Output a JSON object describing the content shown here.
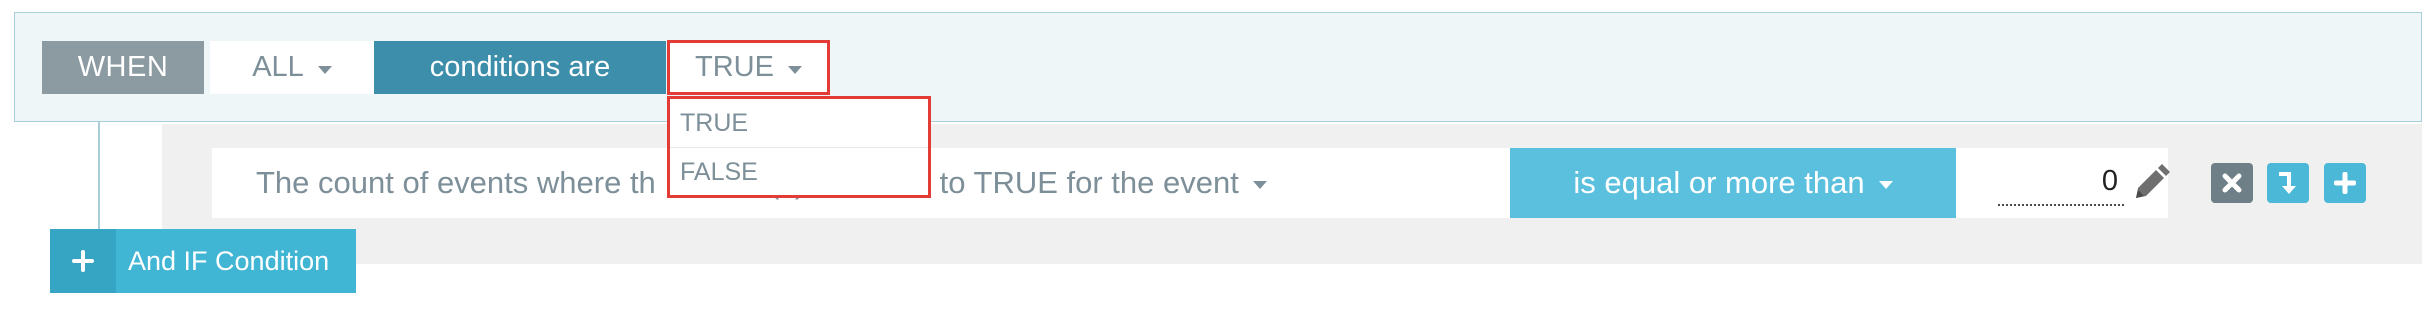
{
  "when_bar": {
    "when_label": "WHEN",
    "all_select": "ALL",
    "conditions_label": "conditions are",
    "true_select": "TRUE"
  },
  "dropdown": {
    "options": [
      "TRUE",
      "FALSE"
    ]
  },
  "condition_row": {
    "count_select_visible_left": "The count of events where th",
    "count_select_visible_right": "n(s) evaluate to TRUE for the event",
    "operator_select": "is equal or more than",
    "value": "0"
  },
  "actions": {
    "and_if_label": "And IF Condition"
  },
  "icons": {
    "remove": "close-icon",
    "move_down": "move-down-icon",
    "add": "plus-icon",
    "edit": "pencil-icon",
    "caret": "caret-down-icon"
  },
  "colors": {
    "when_bg": "#8c9aa1",
    "conditions_bg": "#3d8eaa",
    "operator_bg": "#5bc0de",
    "highlight": "#e33b36",
    "button_blue": "#4bb8d8",
    "button_gray": "#6f7f87"
  }
}
